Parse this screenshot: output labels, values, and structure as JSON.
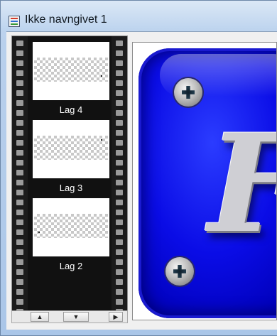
{
  "window": {
    "title": "Ikke navngivet 1",
    "app_icon": "paint-app-icon"
  },
  "layers": [
    {
      "label": "Lag 4"
    },
    {
      "label": "Lag 3"
    },
    {
      "label": "Lag 2"
    }
  ],
  "scrollbar": {
    "up_icon": "arrow-up-icon",
    "down_icon": "arrow-down-icon",
    "right_icon": "arrow-right-icon",
    "up_glyph": "▲",
    "down_glyph": "▼",
    "right_glyph": "▶"
  },
  "canvas": {
    "content": "badge-image",
    "letter": "F",
    "colors": {
      "badge": "#0000d8",
      "letter": "#cfcfd4"
    }
  }
}
